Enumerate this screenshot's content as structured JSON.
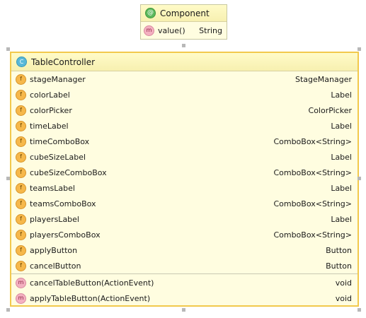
{
  "component": {
    "title": "Component",
    "header_icon": "annotation-icon",
    "members": [
      {
        "icon": "method-icon",
        "letter": "m",
        "name": "value()",
        "type": "String"
      }
    ]
  },
  "table_controller": {
    "title": "TableController",
    "header_icon": "class-icon",
    "header_letter": "C",
    "fields": [
      {
        "letter": "f",
        "name": "stageManager",
        "type": "StageManager"
      },
      {
        "letter": "f",
        "name": "colorLabel",
        "type": "Label"
      },
      {
        "letter": "f",
        "name": "colorPicker",
        "type": "ColorPicker"
      },
      {
        "letter": "f",
        "name": "timeLabel",
        "type": "Label"
      },
      {
        "letter": "f",
        "name": "timeComboBox",
        "type": "ComboBox<String>"
      },
      {
        "letter": "f",
        "name": "cubeSizeLabel",
        "type": "Label"
      },
      {
        "letter": "f",
        "name": "cubeSizeComboBox",
        "type": "ComboBox<String>"
      },
      {
        "letter": "f",
        "name": "teamsLabel",
        "type": "Label"
      },
      {
        "letter": "f",
        "name": "teamsComboBox",
        "type": "ComboBox<String>"
      },
      {
        "letter": "f",
        "name": "playersLabel",
        "type": "Label"
      },
      {
        "letter": "f",
        "name": "playersComboBox",
        "type": "ComboBox<String>"
      },
      {
        "letter": "f",
        "name": "applyButton",
        "type": "Button"
      },
      {
        "letter": "f",
        "name": "cancelButton",
        "type": "Button"
      }
    ],
    "methods": [
      {
        "letter": "m",
        "name": "cancelTableButton(ActionEvent)",
        "type": "void"
      },
      {
        "letter": "m",
        "name": "applyTableButton(ActionEvent)",
        "type": "void"
      }
    ]
  },
  "colors": {
    "selection_border": "#f2c94c",
    "node_background": "#fffde0",
    "field_icon": "#f6b84a",
    "method_icon": "#f4b0c0",
    "class_icon": "#58b8d8",
    "annotation_icon": "#5cb85c"
  }
}
